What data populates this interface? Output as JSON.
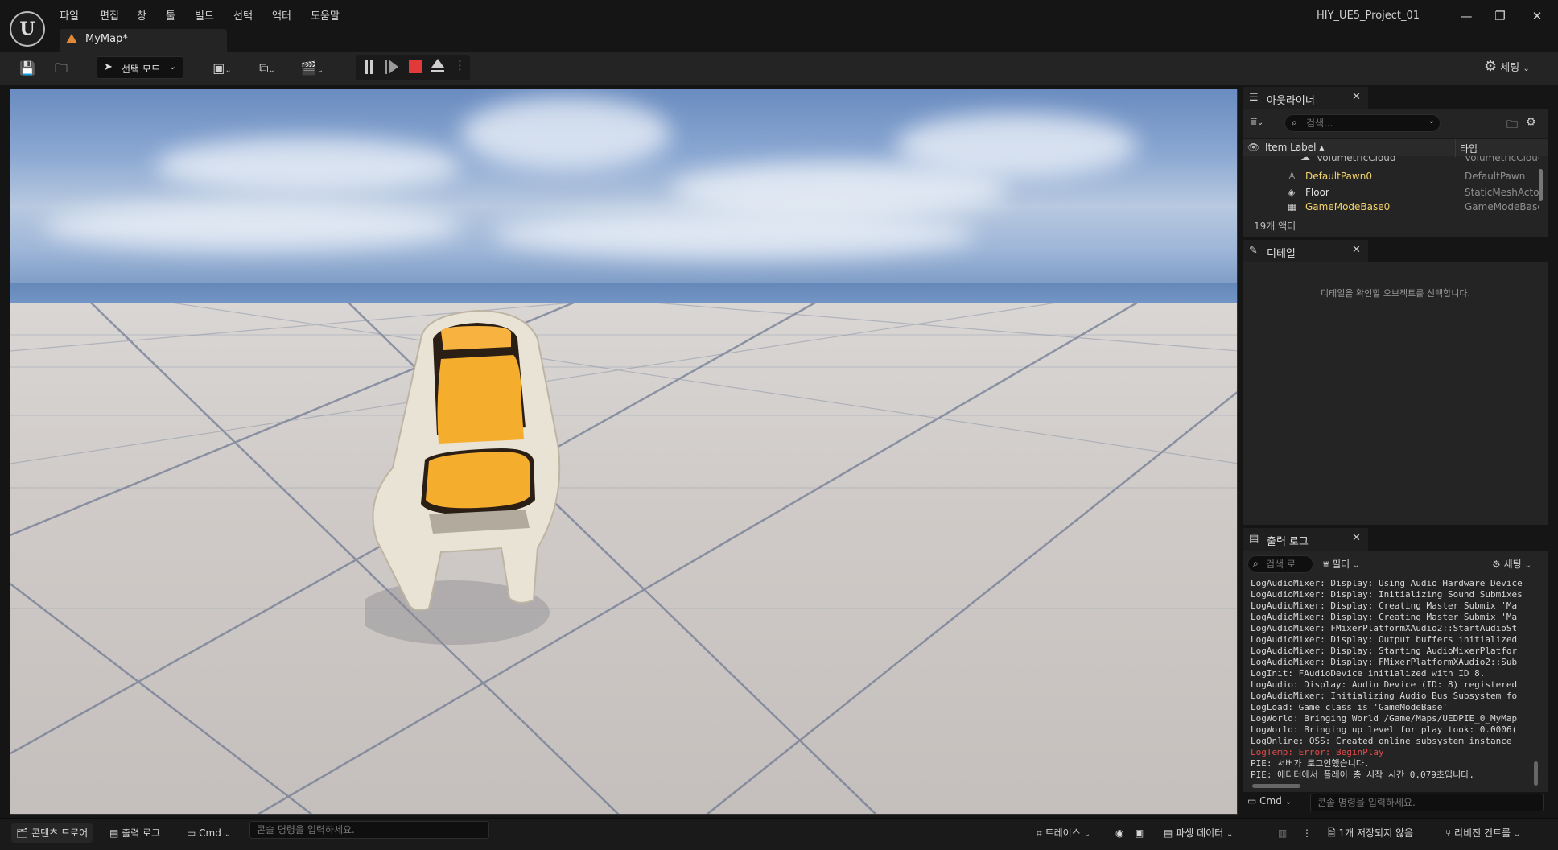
{
  "titlebar": {
    "menus": [
      "파일",
      "편집",
      "창",
      "툴",
      "빌드",
      "선택",
      "액터",
      "도움말"
    ],
    "project_title": "HIY_UE5_Project_01",
    "window_controls": {
      "minimize": "—",
      "restore": "❐",
      "close": "✕"
    },
    "logo": "U",
    "doc_tab": "MyMap*"
  },
  "toolbar": {
    "select_mode_label": "선택 모드",
    "settings_label": "세팅"
  },
  "outliner": {
    "tab_label": "아웃라이너",
    "search_placeholder": "검색...",
    "column_label": "Item Label ▴",
    "column_type": "타입",
    "rows": [
      {
        "label": "VolumetricCloud",
        "type": "VolumetricCloud",
        "icon": "cloud-icon"
      },
      {
        "label": "DefaultPawn0",
        "type": "DefaultPawn",
        "icon": "pawn-icon"
      },
      {
        "label": "Floor",
        "type": "StaticMeshActor",
        "icon": "mesh-icon"
      },
      {
        "label": "GameModeBase0",
        "type": "GameModeBase",
        "icon": "gamemode-icon"
      }
    ],
    "actor_count": "19개 액터"
  },
  "details": {
    "tab_label": "디테일",
    "empty_message": "디테일을 확인할 오브젝트를 선택합니다."
  },
  "output_log": {
    "tab_label": "출력 로그",
    "search_placeholder": "검색 로",
    "filter_label": "필터",
    "settings_label": "세팅",
    "lines": [
      {
        "text": "LogAudioMixer: Display: Using Audio Hardware Device",
        "error": false
      },
      {
        "text": "LogAudioMixer: Display: Initializing Sound Submixes",
        "error": false
      },
      {
        "text": "LogAudioMixer: Display: Creating Master Submix 'Ma",
        "error": false
      },
      {
        "text": "LogAudioMixer: Display: Creating Master Submix 'Ma",
        "error": false
      },
      {
        "text": "LogAudioMixer: FMixerPlatformXAudio2::StartAudioSt",
        "error": false
      },
      {
        "text": "LogAudioMixer: Display: Output buffers initialized",
        "error": false
      },
      {
        "text": "LogAudioMixer: Display: Starting AudioMixerPlatfor",
        "error": false
      },
      {
        "text": "LogAudioMixer: Display: FMixerPlatformXAudio2::Sub",
        "error": false
      },
      {
        "text": "LogInit: FAudioDevice initialized with ID 8.",
        "error": false
      },
      {
        "text": "LogAudio: Display: Audio Device (ID: 8) registered",
        "error": false
      },
      {
        "text": "LogAudioMixer: Initializing Audio Bus Subsystem fo",
        "error": false
      },
      {
        "text": "LogLoad: Game class is 'GameModeBase'",
        "error": false
      },
      {
        "text": "LogWorld: Bringing World /Game/Maps/UEDPIE_0_MyMap",
        "error": false
      },
      {
        "text": "LogWorld: Bringing up level for play took: 0.0006(",
        "error": false
      },
      {
        "text": "LogOnline: OSS: Created online subsystem instance",
        "error": false
      },
      {
        "text": "LogTemp: Error: BeginPlay",
        "error": true
      },
      {
        "text": "PIE: 서버가 로그인했습니다.",
        "error": false
      },
      {
        "text": "PIE: 에디터에서 플레이 총 시작 시간 0.079초입니다.",
        "error": false
      }
    ],
    "cmd_label": "Cmd",
    "console_placeholder": "콘솔 명령을 입력하세요."
  },
  "statusbar": {
    "content_drawer": "콘텐츠 드로어",
    "output_log": "출력 로그",
    "cmd_label": "Cmd",
    "console_placeholder": "콘솔 명령을 입력하세요.",
    "trace": "트레이스",
    "derived_data": "파생 데이터",
    "unsaved": "1개 저장되지 않음",
    "revision_control": "리비전 컨트롤"
  },
  "colors": {
    "stop_button": "#e23a3a",
    "error_text": "#e84a4a",
    "chair_cushion": "#f2b33a",
    "map_tab_icon": "#e0893a"
  }
}
